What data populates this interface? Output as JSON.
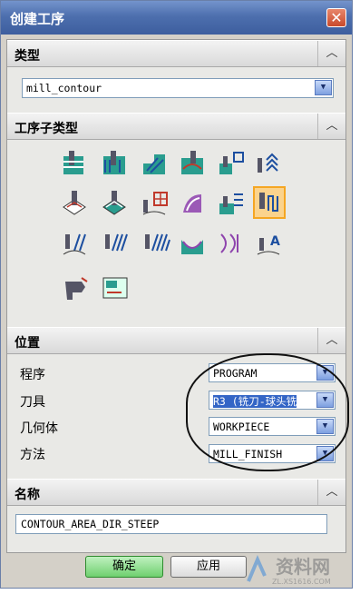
{
  "window": {
    "title": "创建工序",
    "close_glyph": "✕"
  },
  "sections": {
    "type": {
      "label": "类型",
      "value": "mill_contour"
    },
    "subtype": {
      "label": "工序子类型"
    },
    "location": {
      "label": "位置",
      "rows": [
        {
          "label": "程序",
          "value": "PROGRAM"
        },
        {
          "label": "刀具",
          "value": "R3 (铣刀-球头铣"
        },
        {
          "label": "几何体",
          "value": "WORKPIECE"
        },
        {
          "label": "方法",
          "value": "MILL_FINISH"
        }
      ]
    },
    "name": {
      "label": "名称",
      "value": "CONTOUR_AREA_DIR_STEEP"
    }
  },
  "buttons": {
    "ok": "确定",
    "apply": "应用"
  },
  "watermark": {
    "text": "资料网",
    "sub": "ZL.XS1616.COM"
  },
  "colors": {
    "titlebar": "#4d6fae",
    "selected_icon": "#f5a623"
  }
}
